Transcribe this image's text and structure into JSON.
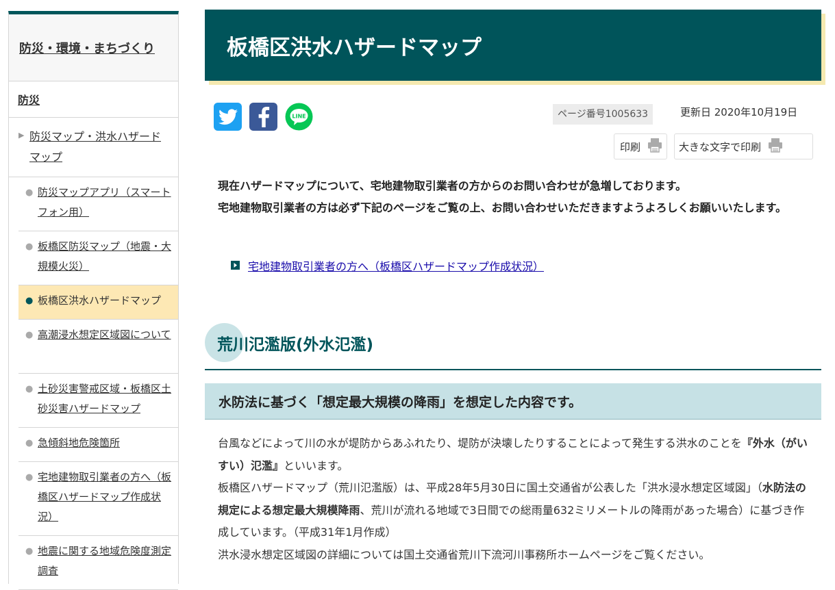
{
  "sidebar": {
    "heading": "防災・環境・まちづくり",
    "section": "防災",
    "parent": "防災マップ・洪水ハザードマップ",
    "items": [
      {
        "label": "防災マップアプリ（スマートフォン用）"
      },
      {
        "label": "板橋区防災マップ（地震・大規模火災）"
      },
      {
        "label": "板橋区洪水ハザードマップ"
      },
      {
        "label": "高潮浸水想定区域図について"
      },
      {
        "label": "土砂災害警戒区域・板橋区土砂災害ハザードマップ"
      },
      {
        "label": "急傾斜地危険箇所"
      },
      {
        "label": "宅地建物取引業者の方へ（板橋区ハザードマップ作成状況）"
      },
      {
        "label": "地震に関する地域危険度測定調査"
      }
    ]
  },
  "page": {
    "title": "板橋区洪水ハザードマップ",
    "page_number": "ページ番号1005633",
    "updated": "更新日 2020年10月19日",
    "print_label": "印刷",
    "print_large_label": "大きな文字で印刷"
  },
  "social": {
    "line_text": "LINE"
  },
  "notice": {
    "line1": "現在ハザードマップについて、宅地建物取引業者の方からのお問い合わせが急増しております。",
    "line2": "宅地建物取引業者の方は必ず下記のページをご覧の上、お問い合わせいただきますようよろしくお願いいたします。"
  },
  "link": {
    "text": "宅地建物取引業者の方へ（板橋区ハザードマップ作成状況）"
  },
  "section": {
    "h2": "荒川氾濫版(外水氾濫)",
    "h3": "水防法に基づく「想定最大規模の降雨」を想定した内容です。"
  },
  "body": {
    "p1_a": "台風などによって川の水が堤防からあふれたり、堤防が決壊したりすることによって発生する洪水のことを",
    "p1_bold": "『外水（がいすい）氾濫』",
    "p1_b": "といいます。",
    "p2_a": "板橋区ハザードマップ（荒川氾濫版）は、平成28年5月30日に国土交通省が公表した「洪水浸水想定区域図」（",
    "p2_bold": "水防法の規定による想定最大規模降雨",
    "p2_b": "、荒川が流れる地域で3日間での総雨量632ミリメートルの降雨があった場合）に基づき作成しています。（平成31年1月作成）",
    "p3": "洪水浸水想定区域図の詳細については国土交通省荒川下流河川事務所ホームページをご覧ください。"
  },
  "colors": {
    "brand": "#00545a",
    "title_shadow": "#f5e9b0",
    "active_item": "#fde8b4",
    "h3_bg": "#c6e1e5",
    "twitter": "#1da1f2",
    "facebook": "#3b5998",
    "line": "#06c755"
  }
}
